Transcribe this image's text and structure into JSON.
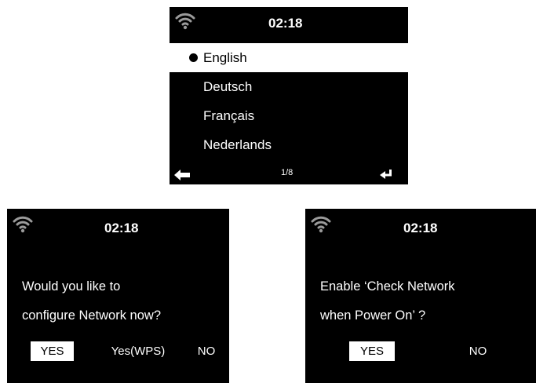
{
  "language_screen": {
    "time": "02:18",
    "items": [
      {
        "label": "English"
      },
      {
        "label": "Deutsch"
      },
      {
        "label": "Français"
      },
      {
        "label": "Nederlands"
      }
    ],
    "selected_index": 0,
    "page_indicator": "1/8"
  },
  "network_dialog": {
    "time": "02:18",
    "message_line1": "Would you like to",
    "message_line2": "configure Network now?",
    "options": [
      {
        "label": "YES"
      },
      {
        "label": "Yes(WPS)"
      },
      {
        "label": "NO"
      }
    ],
    "highlighted_index": 0
  },
  "check_network_dialog": {
    "time": "02:18",
    "message_line1": "Enable ‘Check Network",
    "message_line2": "when Power On’ ?",
    "options": [
      {
        "label": "YES"
      },
      {
        "label": "NO"
      }
    ],
    "highlighted_index": 0
  },
  "icons": {
    "status": "wifi-icon",
    "back": "back-arrow-icon",
    "enter": "enter-icon",
    "selection": "bullet-icon"
  },
  "colors": {
    "screen_bg": "#000000",
    "text": "#ffffff",
    "highlight_bg": "#ffffff",
    "highlight_text": "#000000",
    "wifi_icon": "#9a9a9a"
  }
}
